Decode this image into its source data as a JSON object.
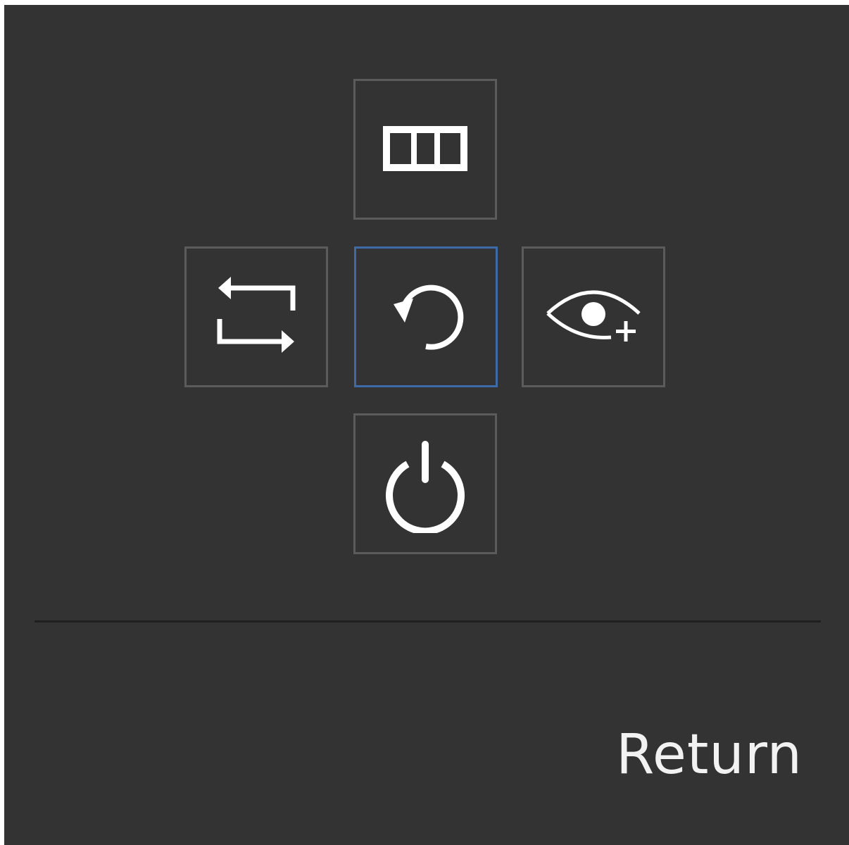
{
  "osd": {
    "tiles": {
      "up": {
        "icon": "picture-mode-icon"
      },
      "left": {
        "icon": "source-switch-icon"
      },
      "center": {
        "icon": "return-icon",
        "selected": true
      },
      "right": {
        "icon": "eye-saver-icon"
      },
      "down": {
        "icon": "power-icon"
      }
    },
    "footer": {
      "label": "Return"
    }
  },
  "colors": {
    "background": "#333333",
    "tile_border": "#5b5b5b",
    "selected_border": "#3f6aa8",
    "icon": "#ffffff",
    "text": "#f2f2f2"
  }
}
